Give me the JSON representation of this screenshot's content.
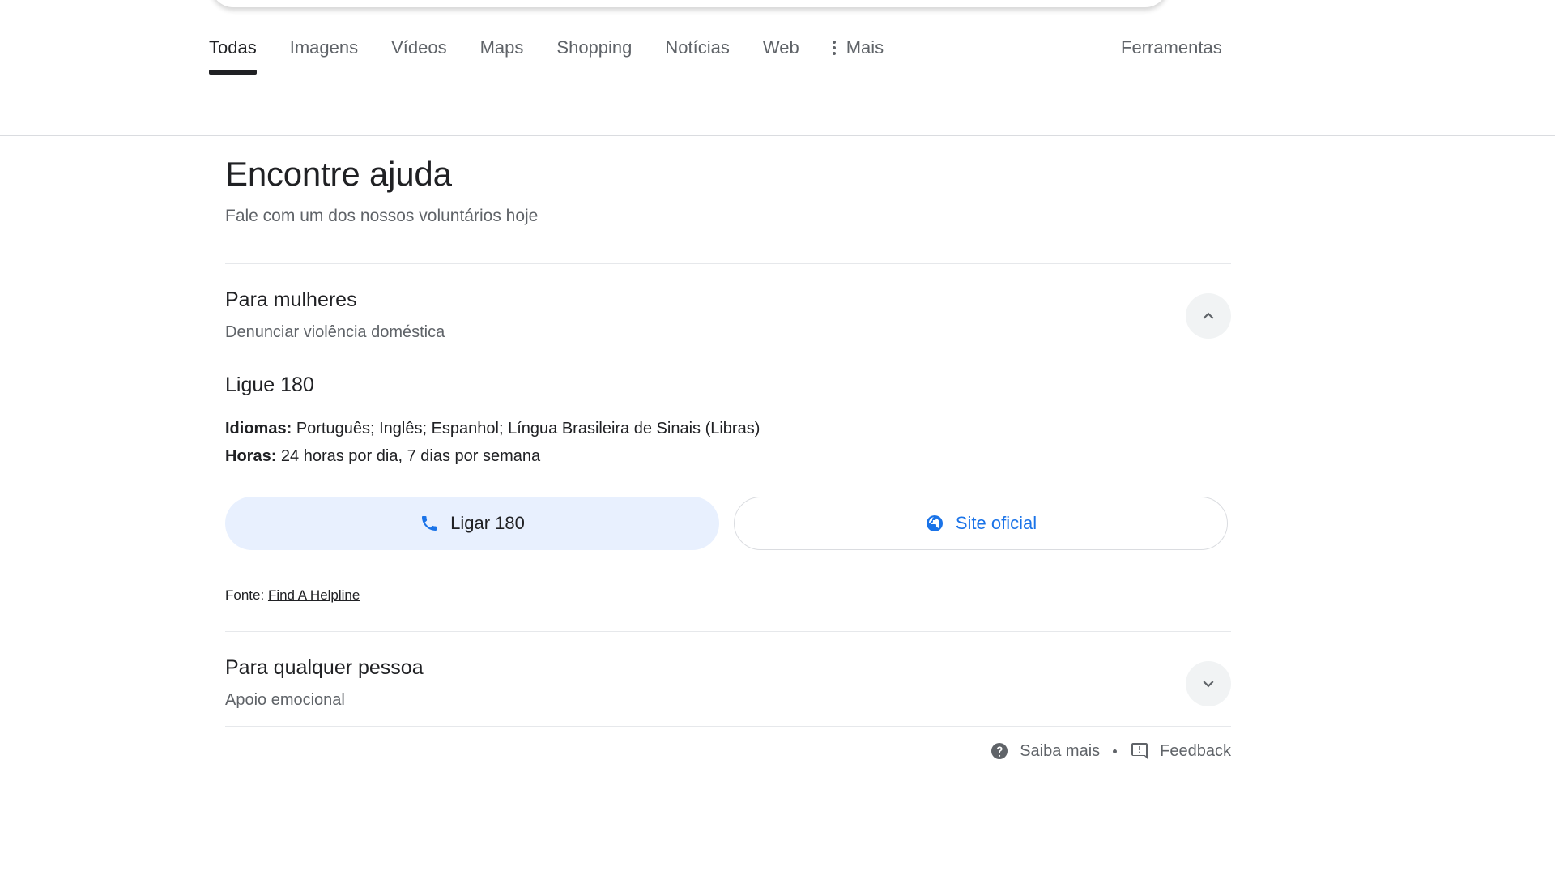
{
  "nav": {
    "tabs": [
      {
        "label": "Todas",
        "active": true
      },
      {
        "label": "Imagens",
        "active": false
      },
      {
        "label": "Vídeos",
        "active": false
      },
      {
        "label": "Maps",
        "active": false
      },
      {
        "label": "Shopping",
        "active": false
      },
      {
        "label": "Notícias",
        "active": false
      },
      {
        "label": "Web",
        "active": false
      }
    ],
    "more_label": "Mais",
    "more_icon": "kebab-menu-icon",
    "tools_label": "Ferramentas"
  },
  "panel": {
    "title": "Encontre ajuda",
    "subtitle": "Fale com um dos nossos voluntários hoje",
    "sections": [
      {
        "name": "Para mulheres",
        "description": "Denunciar violência doméstica",
        "expanded": true,
        "toggle_icon": "chevron-up-icon",
        "helpline_name": "Ligue 180",
        "meta": [
          {
            "label": "Idiomas:",
            "value": "Português; Inglês; Espanhol; Língua Brasileira de Sinais (Libras)"
          },
          {
            "label": "Horas:",
            "value": "24 horas por dia, 7 dias por semana"
          }
        ],
        "actions": {
          "call_label": "Ligar 180",
          "call_icon": "phone-icon",
          "site_label": "Site oficial",
          "site_icon": "globe-icon"
        },
        "source_label": "Fonte:",
        "source_link": "Find A Helpline"
      },
      {
        "name": "Para qualquer pessoa",
        "description": "Apoio emocional",
        "expanded": false,
        "toggle_icon": "chevron-down-icon"
      }
    ]
  },
  "footer": {
    "learn_more_label": "Saiba mais",
    "learn_more_icon": "help-circle-icon",
    "separator": "•",
    "feedback_label": "Feedback",
    "feedback_icon": "feedback-icon"
  },
  "colors": {
    "accent_blue": "#1a73e8",
    "call_button_bg": "#e8f0fe",
    "text_primary": "#202124",
    "text_secondary": "#5f6368",
    "divider": "#dadce0",
    "toggle_bg": "#f1f3f4"
  }
}
